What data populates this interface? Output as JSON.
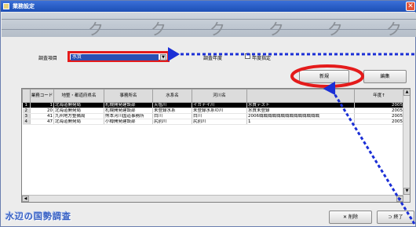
{
  "window": {
    "title": "業務設定",
    "close_glyph": "✕"
  },
  "banner": {
    "swirls": [
      "ク",
      "ク",
      "ク",
      "ク",
      "ク",
      "ク"
    ]
  },
  "filters": {
    "survey_item_label": "調査項目",
    "survey_item_value": "水質",
    "dropdown_glyph": "▼",
    "condition_label": "調査年度",
    "checkbox_label": "年度指定"
  },
  "buttons": {
    "new": "新規",
    "edit": "編集",
    "delete": "✕ 削除",
    "close": "⊃ 終了"
  },
  "table": {
    "headers": [
      "業務コード",
      "地整・都道府県名",
      "事務所名",
      "水系名",
      "河川名",
      "",
      "年度↑"
    ],
    "rows": [
      {
        "no": "1",
        "code": "1",
        "region": "北海道開発局",
        "office": "札幌開発建設部",
        "system": "天塩川",
        "river": "イガナイ川",
        "name": "水質テスト",
        "year": "2005"
      },
      {
        "no": "2",
        "code": "20",
        "region": "北海道開発局",
        "office": "札幌開発建設部",
        "system": "未登録水系",
        "river": "未登録水系の川",
        "name": "水質未登録",
        "year": "2005"
      },
      {
        "no": "3",
        "code": "41",
        "region": "九州地方整備局",
        "office": "熊本河川国道事務所",
        "system": "白川",
        "river": "白川",
        "name": "2006職職職職職職職職職職職職職職",
        "year": "2005"
      },
      {
        "no": "4",
        "code": "47",
        "region": "北海道開発局",
        "office": "小樽開発建設部",
        "system": "尻別川",
        "river": "尻別川",
        "name": "1",
        "year": "2005"
      }
    ]
  },
  "logo": {
    "text": "水辺の国勢調査"
  },
  "colors": {
    "highlight": "#e41b1b",
    "pointer": "#1b2fd6",
    "titlebar": "#2457c5"
  }
}
